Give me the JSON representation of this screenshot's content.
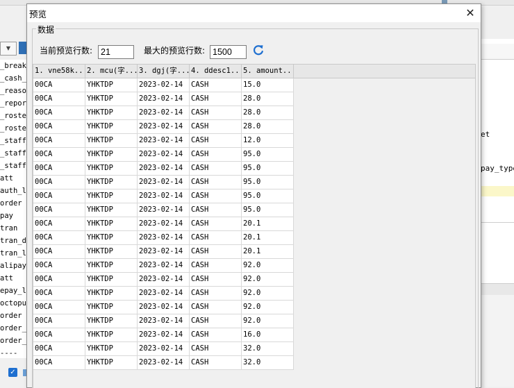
{
  "background": {
    "dropdown_glyph": "▼",
    "tree_items": [
      "_break_",
      "_cash_f",
      "_reason",
      "_report",
      "_roster",
      "_roster",
      "_staff_",
      "_staff_",
      "_staff_",
      "att",
      "auth_lo",
      "order",
      "pay",
      "tran",
      "tran_di",
      "tran_lo",
      "alipay",
      "att",
      "epay_lo",
      "octopus",
      "order",
      "order_c",
      "order_c",
      "----"
    ],
    "code_snippets": [
      "et",
      "pay_type"
    ]
  },
  "dialog": {
    "title": "预览",
    "close_glyph": "✕",
    "group_label": "数据",
    "current_rows_label": "当前预览行数:",
    "current_rows_value": "21",
    "max_rows_label": "最大的预览行数:",
    "max_rows_value": "1500",
    "refresh_icon": "refresh-icon"
  },
  "grid": {
    "columns": [
      "1. vne58k...",
      "2. mcu(字...",
      "3. dgj(字...",
      "4. ddesc1...",
      "5. amount..."
    ],
    "rows": [
      [
        "00CA",
        "YHKTDP",
        "2023-02-14",
        "CASH",
        "15.0"
      ],
      [
        "00CA",
        "YHKTDP",
        "2023-02-14",
        "CASH",
        "28.0"
      ],
      [
        "00CA",
        "YHKTDP",
        "2023-02-14",
        "CASH",
        "28.0"
      ],
      [
        "00CA",
        "YHKTDP",
        "2023-02-14",
        "CASH",
        "28.0"
      ],
      [
        "00CA",
        "YHKTDP",
        "2023-02-14",
        "CASH",
        "12.0"
      ],
      [
        "00CA",
        "YHKTDP",
        "2023-02-14",
        "CASH",
        "95.0"
      ],
      [
        "00CA",
        "YHKTDP",
        "2023-02-14",
        "CASH",
        "95.0"
      ],
      [
        "00CA",
        "YHKTDP",
        "2023-02-14",
        "CASH",
        "95.0"
      ],
      [
        "00CA",
        "YHKTDP",
        "2023-02-14",
        "CASH",
        "95.0"
      ],
      [
        "00CA",
        "YHKTDP",
        "2023-02-14",
        "CASH",
        "95.0"
      ],
      [
        "00CA",
        "YHKTDP",
        "2023-02-14",
        "CASH",
        "20.1"
      ],
      [
        "00CA",
        "YHKTDP",
        "2023-02-14",
        "CASH",
        "20.1"
      ],
      [
        "00CA",
        "YHKTDP",
        "2023-02-14",
        "CASH",
        "20.1"
      ],
      [
        "00CA",
        "YHKTDP",
        "2023-02-14",
        "CASH",
        "92.0"
      ],
      [
        "00CA",
        "YHKTDP",
        "2023-02-14",
        "CASH",
        "92.0"
      ],
      [
        "00CA",
        "YHKTDP",
        "2023-02-14",
        "CASH",
        "92.0"
      ],
      [
        "00CA",
        "YHKTDP",
        "2023-02-14",
        "CASH",
        "92.0"
      ],
      [
        "00CA",
        "YHKTDP",
        "2023-02-14",
        "CASH",
        "92.0"
      ],
      [
        "00CA",
        "YHKTDP",
        "2023-02-14",
        "CASH",
        "16.0"
      ],
      [
        "00CA",
        "YHKTDP",
        "2023-02-14",
        "CASH",
        "32.0"
      ],
      [
        "00CA",
        "YHKTDP",
        "2023-02-14",
        "CASH",
        "32.0"
      ]
    ]
  },
  "colors": {
    "accent": "#1e6fd0",
    "highlight": "#fbf7c9",
    "dialog_bg": "#f0f0f0"
  }
}
